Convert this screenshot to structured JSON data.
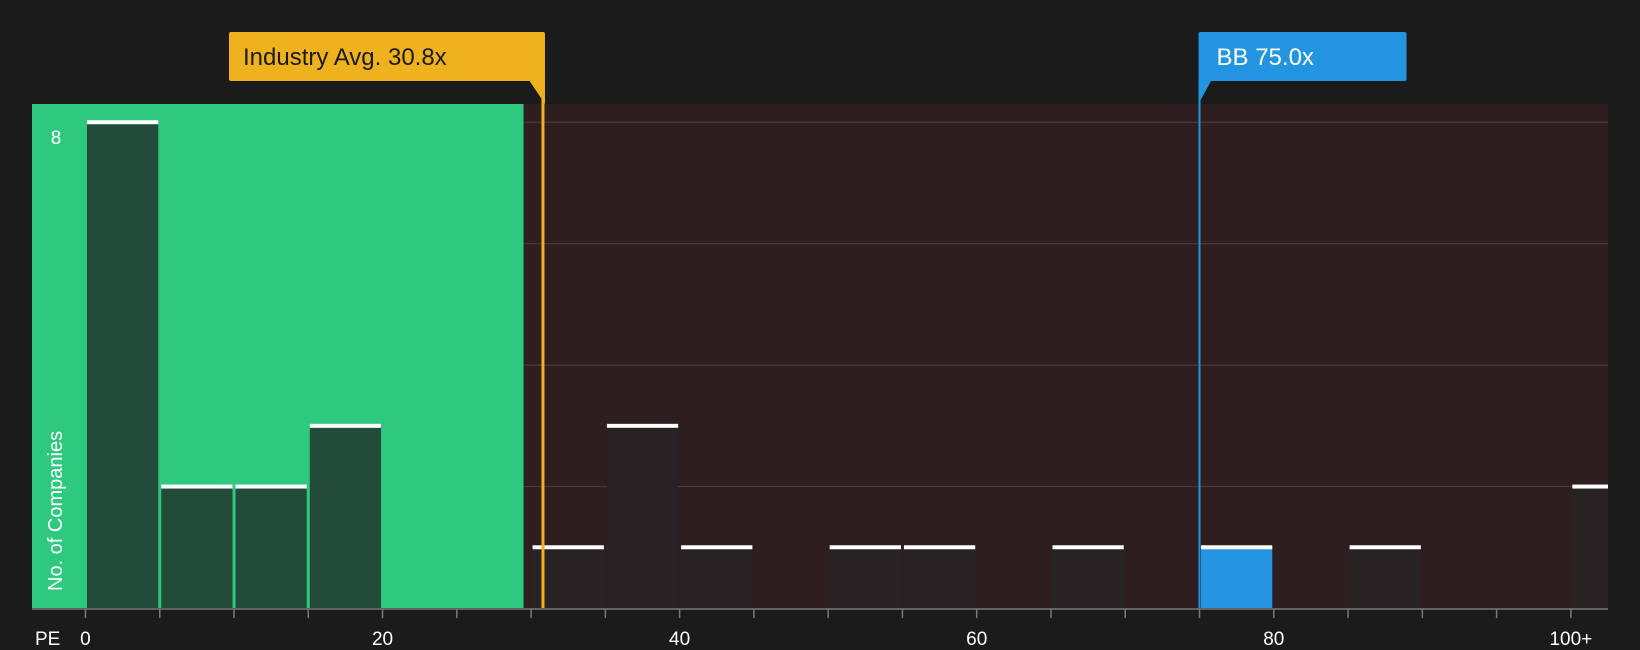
{
  "colors": {
    "background": "#1b1b1b",
    "undervalued_zone": "#2ec97e",
    "overvalued_zone": "#2e1e1f",
    "bar_in_green": "#234b39",
    "bar_in_red": "#272223",
    "bar_cap": "#ffffff",
    "industry_callout": "#eeb21f",
    "company_callout": "#2394e0",
    "gridline": "#4a3c3d"
  },
  "chart_data": {
    "type": "bar",
    "x_axis_label": "PE",
    "y_axis_label": "No. of Companies",
    "y_tick_labels": [
      {
        "value": 8,
        "label": "8"
      }
    ],
    "x_tick_labels": [
      {
        "value": 0,
        "label": "0"
      },
      {
        "value": 20,
        "label": "20"
      },
      {
        "value": 40,
        "label": "40"
      },
      {
        "value": 60,
        "label": "60"
      },
      {
        "value": 80,
        "label": "80"
      },
      {
        "value": 100,
        "label": "100+"
      }
    ],
    "x_range": [
      -3.6,
      102.5
    ],
    "y_range": [
      0,
      8.3
    ],
    "gridlines": [
      2,
      4,
      6,
      8
    ],
    "bin_width": 5,
    "bins": [
      {
        "start": 0,
        "count": 8
      },
      {
        "start": 5,
        "count": 2
      },
      {
        "start": 10,
        "count": 2
      },
      {
        "start": 15,
        "count": 3
      },
      {
        "start": 30,
        "count": 1
      },
      {
        "start": 35,
        "count": 3
      },
      {
        "start": 40,
        "count": 1
      },
      {
        "start": 50,
        "count": 1
      },
      {
        "start": 55,
        "count": 1
      },
      {
        "start": 65,
        "count": 1
      },
      {
        "start": 75,
        "count": 1,
        "highlight": true
      },
      {
        "start": 85,
        "count": 1
      },
      {
        "start": 100,
        "count": 2
      }
    ],
    "undervalued_zone_max": 29.5,
    "industry_avg": {
      "value": 30.8,
      "label": "Industry Avg. 30.8x"
    },
    "company": {
      "value": 75.0,
      "label": "BB 75.0x"
    }
  }
}
